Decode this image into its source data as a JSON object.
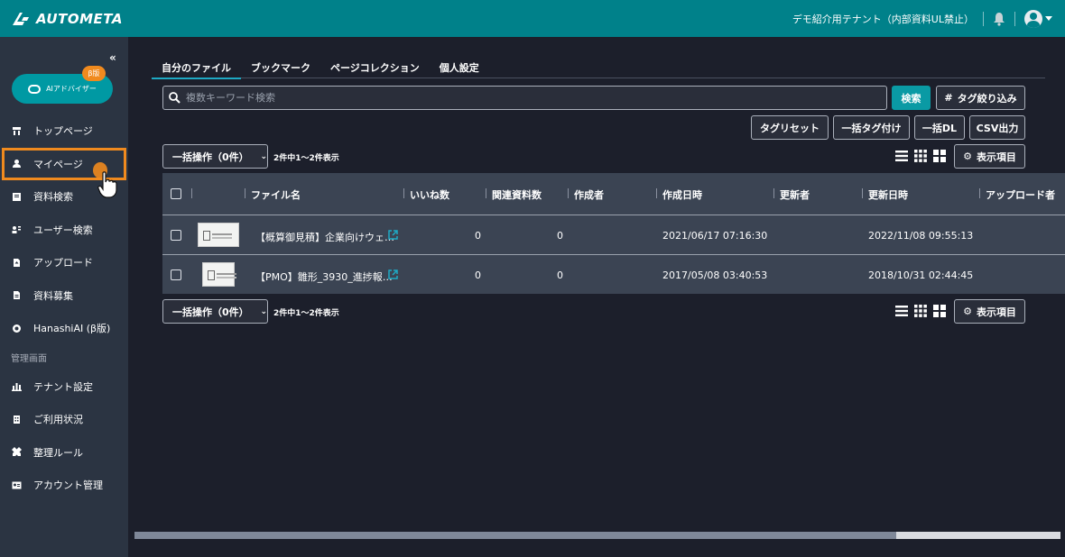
{
  "app": {
    "brand": "AUTOMETA"
  },
  "topbar": {
    "tenant": "デモ紹介用テナント（内部資料UL禁止）"
  },
  "sidebar": {
    "collapse_label": "«",
    "ai_button": "AIアドバイザー",
    "beta_badge": "β版",
    "items": [
      {
        "label": "トップページ",
        "icon": "home-icon"
      },
      {
        "label": "マイページ",
        "icon": "user-icon"
      },
      {
        "label": "資料検索",
        "icon": "document-search-icon"
      },
      {
        "label": "ユーザー検索",
        "icon": "user-search-icon"
      },
      {
        "label": "アップロード",
        "icon": "upload-icon"
      },
      {
        "label": "資料募集",
        "icon": "file-request-icon"
      },
      {
        "label": "HanashiAI (β版)",
        "icon": "chat-ai-icon"
      }
    ],
    "admin_section": "管理画面",
    "admin_items": [
      {
        "label": "テナント設定",
        "icon": "tenant-icon"
      },
      {
        "label": "ご利用状況",
        "icon": "usage-icon"
      },
      {
        "label": "整理ルール",
        "icon": "rules-icon"
      },
      {
        "label": "アカウント管理",
        "icon": "account-icon"
      }
    ]
  },
  "main": {
    "tabs": [
      "自分のファイル",
      "ブックマーク",
      "ページコレクション",
      "個人設定"
    ],
    "search": {
      "placeholder": "複数キーワード検索"
    },
    "buttons": {
      "search": "検索",
      "tag_filter": "タグ絞り込み",
      "tag_reset": "タグリセット",
      "bulk_tag": "一括タグ付け",
      "bulk_dl": "一括DL",
      "csv": "CSV出力",
      "display_items": "表示項目"
    },
    "bulk_action": "一括操作（0件）",
    "count_text": "2件中1〜2件表示",
    "columns": [
      "ファイル名",
      "いいね数",
      "関連資料数",
      "作成者",
      "作成日時",
      "更新者",
      "更新日時",
      "アップロード者"
    ],
    "rows": [
      {
        "file": "【概算御見積】企業向けウェ…",
        "likes": "0",
        "related": "0",
        "creator": "",
        "created": "2021/06/17 07:16:30",
        "updater": "",
        "updated": "2022/11/08 09:55:13"
      },
      {
        "file": "【PMO】雛形_3930_進捗報…",
        "likes": "0",
        "related": "0",
        "creator": "",
        "created": "2017/05/08 03:40:53",
        "updater": "",
        "updated": "2018/10/31 02:44:45"
      }
    ]
  },
  "colors": {
    "topbar": "#00818a",
    "accent": "#f08a1e",
    "primary_button": "#0a9aa4"
  }
}
